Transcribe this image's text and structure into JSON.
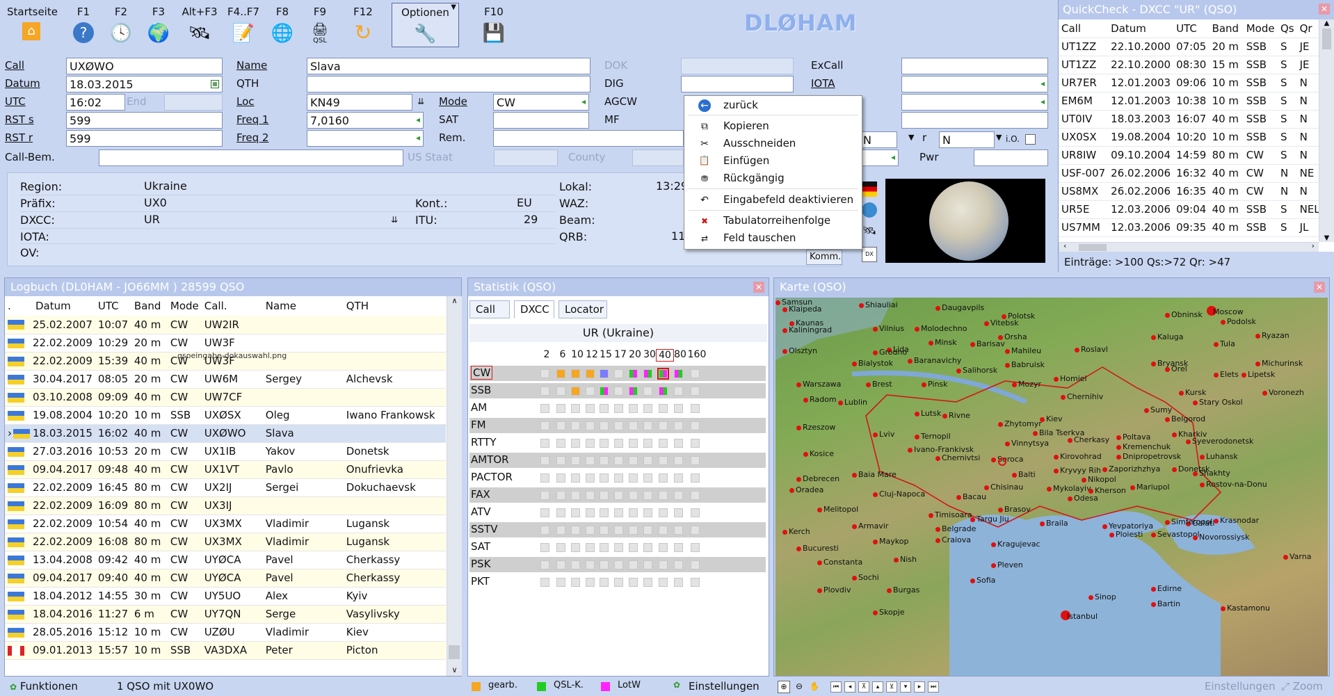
{
  "toolbar": {
    "buttons": [
      {
        "label": "Startseite",
        "icon": "home-icon"
      },
      {
        "label": "F1",
        "icon": "help-icon"
      },
      {
        "label": "F2",
        "icon": "clock-icon"
      },
      {
        "label": "F3",
        "icon": "globe-icon"
      },
      {
        "label": "Alt+F3",
        "icon": "satellite-icon"
      },
      {
        "label": "F4..F7",
        "icon": "notepad-icon"
      },
      {
        "label": "F8",
        "icon": "globe-cd-icon"
      },
      {
        "label": "F9",
        "icon": "qsl-card-icon",
        "sub": "QSL"
      },
      {
        "label": "F12",
        "icon": "refresh-icon"
      },
      {
        "label": "Optionen",
        "icon": "tools-icon"
      },
      {
        "label": "F10",
        "icon": "save-disk-icon"
      }
    ],
    "brand": "DLØHAM"
  },
  "form": {
    "call_label": "Call",
    "call": "UXØWO",
    "datum_label": "Datum",
    "datum": "18.03.2015",
    "utc_label": "UTC",
    "utc": "16:02",
    "end_label": "End",
    "rsts_label": "RST s",
    "rsts": "599",
    "rstr_label": "RST r",
    "rstr": "599",
    "callbem_label": "Call-Bem.",
    "name_label": "Name",
    "name": "Slava",
    "qth_label": "QTH",
    "loc_label": "Loc",
    "loc": "KN49",
    "freq1_label": "Freq 1",
    "freq1": "7,0160",
    "freq2_label": "Freq 2",
    "mode_label": "Mode",
    "mode": "CW",
    "sat_label": "SAT",
    "rem_label": "Rem.",
    "usstaat_label": "US Staat",
    "county_label": "County",
    "dok_label": "DOK",
    "dig_label": "DIG",
    "agcw_label": "AGCW",
    "mf_label": "MF",
    "excall_label": "ExCall",
    "iota_label": "IOTA",
    "pwr_label": "Pwr",
    "n1": "N",
    "r_label": "r",
    "n2": "N",
    "io_label": "i.O."
  },
  "info": {
    "region_label": "Region:",
    "region": "Ukraine",
    "praefix_label": "Präfix:",
    "praefix": "UX0",
    "dxcc_label": "DXCC:",
    "dxcc": "UR",
    "iota_label": "IOTA:",
    "ov_label": "OV:",
    "kont_label": "Kont.:",
    "kont": "EU",
    "itu_label": "ITU:",
    "itu": "29",
    "lokal_label": "Lokal:",
    "lokal": "13:29",
    "waz_label": "WAZ:",
    "beam_label": "Beam:",
    "qrb_label": "QRB:",
    "qrb": "11",
    "komm": "Komm."
  },
  "context_menu": {
    "items": [
      {
        "label": "zurück",
        "icon": "back-arrow-icon"
      },
      {
        "label": "Kopieren",
        "icon": "copy-icon"
      },
      {
        "label": "Ausschneiden",
        "icon": "cut-icon"
      },
      {
        "label": "Einfügen",
        "icon": "paste-icon"
      },
      {
        "label": "Rückgängig",
        "icon": "undo-icon"
      },
      {
        "label": "Eingabefeld deaktivieren",
        "icon": "disable-field-icon"
      },
      {
        "label": "Tabulatorreihenfolge",
        "icon": "tab-order-icon"
      },
      {
        "label": "Feld tauschen",
        "icon": "swap-field-icon"
      }
    ]
  },
  "quickcheck": {
    "title": "QuickCheck - DXCC \"UR\" (QSO)",
    "columns": [
      "Call",
      "Datum",
      "UTC",
      "Band",
      "Mode",
      "Qs",
      "Qr"
    ],
    "rows": [
      [
        "UT1ZZ",
        "22.10.2000",
        "07:05",
        "20 m",
        "SSB",
        "S",
        "JE"
      ],
      [
        "UT1ZZ",
        "22.10.2000",
        "08:30",
        "15 m",
        "SSB",
        "S",
        "JE"
      ],
      [
        "UR7ER",
        "12.01.2003",
        "09:06",
        "10 m",
        "SSB",
        "S",
        "N"
      ],
      [
        "EM6M",
        "12.01.2003",
        "10:38",
        "10 m",
        "SSB",
        "S",
        "N"
      ],
      [
        "UT0IV",
        "18.03.2003",
        "16:07",
        "40 m",
        "SSB",
        "S",
        "N"
      ],
      [
        "UX0SX",
        "19.08.2004",
        "10:20",
        "10 m",
        "SSB",
        "S",
        "N"
      ],
      [
        "UR8IW",
        "09.10.2004",
        "14:59",
        "80 m",
        "CW",
        "S",
        "N"
      ],
      [
        "USF-007",
        "26.02.2006",
        "16:32",
        "40 m",
        "CW",
        "N",
        "NE"
      ],
      [
        "US8MX",
        "26.02.2006",
        "16:35",
        "40 m",
        "CW",
        "N",
        "N"
      ],
      [
        "UR5E",
        "12.03.2006",
        "09:04",
        "40 m",
        "SSB",
        "S",
        "NEL"
      ],
      [
        "US7MM",
        "12.03.2006",
        "09:35",
        "40 m",
        "SSB",
        "S",
        "JL"
      ]
    ],
    "footer": "Einträge: >100   Qs:>72   Qr: >47"
  },
  "logbuch": {
    "title": "Logbuch  (DL0HAM - JO66MM )   28599 QSO",
    "columns": [
      ".",
      "Datum",
      "UTC",
      "Band",
      "Mode",
      "Call.",
      "Name",
      "QTH"
    ],
    "rows": [
      [
        "ua",
        "25.02.2007",
        "10:07",
        "40 m",
        "CW",
        "UW2IR",
        "",
        ""
      ],
      [
        "ua",
        "22.02.2009",
        "10:29",
        "20 m",
        "CW",
        "UW3F",
        "",
        ""
      ],
      [
        "ua",
        "22.02.2009",
        "15:39",
        "40 m",
        "CW",
        "UW3F",
        "",
        ""
      ],
      [
        "ua",
        "30.04.2017",
        "08:05",
        "20 m",
        "CW",
        "UW6M",
        "Sergey",
        "Alchevsk"
      ],
      [
        "ua",
        "03.10.2008",
        "09:09",
        "40 m",
        "CW",
        "UW7CF",
        "",
        ""
      ],
      [
        "ua",
        "19.08.2004",
        "10:20",
        "10 m",
        "SSB",
        "UXØSX",
        "Oleg",
        "Iwano Frankowsk"
      ],
      [
        "ua",
        "18.03.2015",
        "16:02",
        "40 m",
        "CW",
        "UXØWO",
        "Slava",
        ""
      ],
      [
        "ua",
        "27.03.2016",
        "10:53",
        "20 m",
        "CW",
        "UX1IB",
        "Yakov",
        "Donetsk"
      ],
      [
        "ua",
        "09.04.2017",
        "09:48",
        "40 m",
        "CW",
        "UX1VT",
        "Pavlo",
        "Onufrievka"
      ],
      [
        "ua",
        "22.02.2009",
        "16:45",
        "80 m",
        "CW",
        "UX2IJ",
        "Sergei",
        "Dokuchaevsk"
      ],
      [
        "ua",
        "22.02.2009",
        "16:09",
        "80 m",
        "CW",
        "UX3IJ",
        "",
        ""
      ],
      [
        "ua",
        "22.02.2009",
        "10:54",
        "40 m",
        "CW",
        "UX3MX",
        "Vladimir",
        "Lugansk"
      ],
      [
        "ua",
        "22.02.2009",
        "16:08",
        "80 m",
        "CW",
        "UX3MX",
        "Vladimir",
        "Lugansk"
      ],
      [
        "ua",
        "13.04.2008",
        "09:42",
        "40 m",
        "CW",
        "UYØCA",
        "Pavel",
        "Cherkassy"
      ],
      [
        "ua",
        "09.04.2017",
        "09:40",
        "40 m",
        "CW",
        "UYØCA",
        "Pavel",
        "Cherkassy"
      ],
      [
        "ua",
        "18.04.2012",
        "14:55",
        "30 m",
        "CW",
        "UY5UO",
        "Alex",
        "Kyiv"
      ],
      [
        "ua",
        "18.04.2016",
        "11:27",
        "6 m",
        "CW",
        "UY7QN",
        "Serge",
        "Vasylivsky"
      ],
      [
        "ua",
        "28.05.2016",
        "15:12",
        "10 m",
        "CW",
        "UZØU",
        "Vladimir",
        "Kiev"
      ],
      [
        "ca",
        "09.01.2013",
        "15:57",
        "10 m",
        "SSB",
        "VA3DXA",
        "Peter",
        "Picton"
      ]
    ],
    "overlay_text": "qsoeingabe-dokauswahl.png",
    "status_func": "Funktionen",
    "status_msg": "1 QSO mit UX0WO"
  },
  "statistik": {
    "title": "Statistik (QSO)",
    "tabs": [
      "Call",
      "DXCC",
      "Locator"
    ],
    "caption": "UR (Ukraine)",
    "bands": [
      "2",
      "6",
      "10",
      "12",
      "15",
      "17",
      "20",
      "30",
      "40",
      "80",
      "160"
    ],
    "modes": [
      "CW",
      "SSB",
      "AM",
      "FM",
      "RTTY",
      "AMTOR",
      "PACTOR",
      "FAX",
      "ATV",
      "SSTV",
      "SAT",
      "PSK",
      "PKT"
    ],
    "legend": {
      "worked": "gearb.",
      "qsl": "QSL-K.",
      "lotw": "LotW",
      "settings": "Einstellungen"
    },
    "colors": {
      "worked": "#f5a623",
      "qsl": "#22cc22",
      "lotw": "#ff22ff",
      "both": "#7b7bff"
    }
  },
  "karte": {
    "title": "Karte (QSO)",
    "cities": [
      "Klaipeda",
      "Shiauliai",
      "Daugavpils",
      "Polotsk",
      "Moscow",
      "Obninsk",
      "Kaunas",
      "Vilnius",
      "Molodechno",
      "Vitebsk",
      "Podolsk",
      "Kaliningrad",
      "Minsk",
      "Orsha",
      "Kaluga",
      "Tula",
      "Ryazan",
      "Olsztyn",
      "Lida",
      "Grodno",
      "Barisav",
      "Mahileu",
      "Roslavl",
      "Baranavichy",
      "Bryansk",
      "Michurinsk",
      "Bialystok",
      "Babruisk",
      "Salihorsk",
      "Orel",
      "Lipetsk",
      "Warszawa",
      "Brest",
      "Pinsk",
      "Mozyr",
      "Homiel",
      "Elets",
      "Voronezh",
      "Radom",
      "Lublin",
      "Chernihiv",
      "Kursk",
      "Stary Oskol",
      "Lutsk",
      "Rivne",
      "Kiev",
      "Sumy",
      "Belgorod",
      "Rzeszow",
      "Zhytomyr",
      "Kharkiv",
      "Lviv",
      "Ternopil",
      "Bila Tserkva",
      "Poltava",
      "Vinnytsya",
      "Cherkasy",
      "Kremenchuk",
      "Syeverodonetsk",
      "Ivano-Frankivsk",
      "Chernivtsi",
      "Kosice",
      "Soroca",
      "Kirovohrad",
      "Dnipropetrovsk",
      "Luhansk",
      "Baia Mare",
      "Kryvyy Rih",
      "Zaporizhzhya",
      "Donetsk",
      "Shakhty",
      "Debrecen",
      "Balti",
      "Rostov-na-Donu",
      "Oradea",
      "Cluj-Napoca",
      "Chisinau",
      "Nikopol",
      "Mykolayiv",
      "Mariupol",
      "Bacau",
      "Odesa",
      "Kherson",
      "Melitopol",
      "Timisoara",
      "Brasov",
      "Galati",
      "Krasnodar",
      "Armavir",
      "Targu Jiu",
      "Braila",
      "Yevpatoriya",
      "Simferopol",
      "Kerch",
      "Belgrade",
      "Ploiesti",
      "Sevastopol",
      "Novorossiysk",
      "Maykop",
      "Craiova",
      "Bucuresti",
      "Kragujevac",
      "Constanta",
      "Nish",
      "Pleven",
      "Varna",
      "Sochi",
      "Sofia",
      "Burgas",
      "Plovdiv",
      "Skopje",
      "Edirne",
      "Sinop",
      "Istanbul",
      "Bartin",
      "Kastamonu",
      "Samsun"
    ],
    "settings": "Einstellungen",
    "zoom": "Zoom"
  }
}
